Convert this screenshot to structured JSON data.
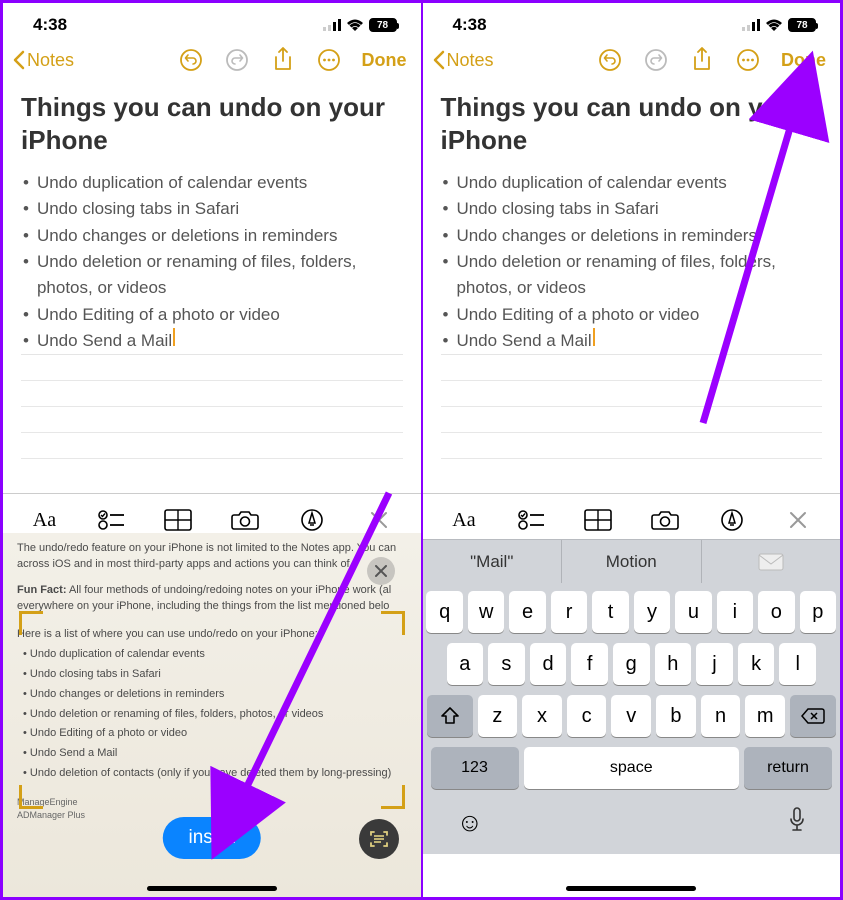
{
  "status": {
    "time": "4:38",
    "battery": "78"
  },
  "nav": {
    "back_label": "Notes",
    "done": "Done"
  },
  "note": {
    "title": "Things you can undo on your iPhone",
    "bullets": [
      "Undo duplication of calendar events",
      "Undo closing tabs in Safari",
      "Undo changes or deletions in reminders",
      "Undo deletion or renaming of files, folders, photos, or videos",
      "Undo Editing of a photo or video",
      "Undo Send a Mail"
    ]
  },
  "scan": {
    "line1": "The undo/redo feature on your iPhone is not limited to the Notes app. You can",
    "line2": "across iOS and in most third-party apps and actions you can think of.",
    "fun_label": "Fun Fact:",
    "fun_text": "All four methods of undoing/redoing notes on your iPhone work (al",
    "fun_text2": "everywhere on your iPhone, including the things from the list mentioned belo",
    "intro": "Here is a list of where you can use undo/redo on your iPhone:",
    "items": [
      "Undo duplication of calendar events",
      "Undo closing tabs in Safari",
      "Undo changes or deletions in reminders",
      "Undo deletion or renaming of files, folders, photos, or videos",
      "Undo Editing of a photo or video",
      "Undo Send a Mail",
      "Undo deletion of contacts (only if you have deleted them by long-pressing)"
    ],
    "insert": "insert",
    "ad1": "ManageEngine",
    "ad2": "ADManager Plus"
  },
  "keyboard": {
    "suggest": [
      "\"Mail\"",
      "Motion",
      ""
    ],
    "row1": [
      "q",
      "w",
      "e",
      "r",
      "t",
      "y",
      "u",
      "i",
      "o",
      "p"
    ],
    "row2": [
      "a",
      "s",
      "d",
      "f",
      "g",
      "h",
      "j",
      "k",
      "l"
    ],
    "row3": [
      "z",
      "x",
      "c",
      "v",
      "b",
      "n",
      "m"
    ],
    "k123": "123",
    "space": "space",
    "return": "return"
  },
  "fmt": {
    "aa": "Aa"
  }
}
